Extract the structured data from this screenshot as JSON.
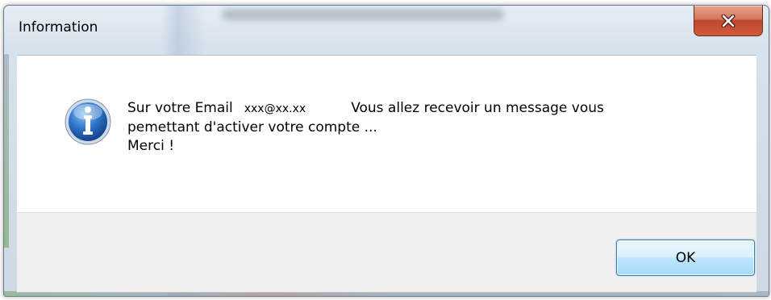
{
  "window": {
    "title": "Information",
    "close_icon": "close-x-icon",
    "close_color": "#c0462b"
  },
  "message": {
    "icon": "information-icon",
    "prefix": "Sur votre Email",
    "email": "xxx@xx.xx",
    "line1_suffix": "Vous allez recevoir un message vous",
    "line2": "pemettant d'activer votre compte ...",
    "line3": "Merci !"
  },
  "buttons": {
    "ok_label": "OK"
  },
  "colors": {
    "info_icon": "#1f5fae",
    "ok_border": "#3c7fb1"
  }
}
